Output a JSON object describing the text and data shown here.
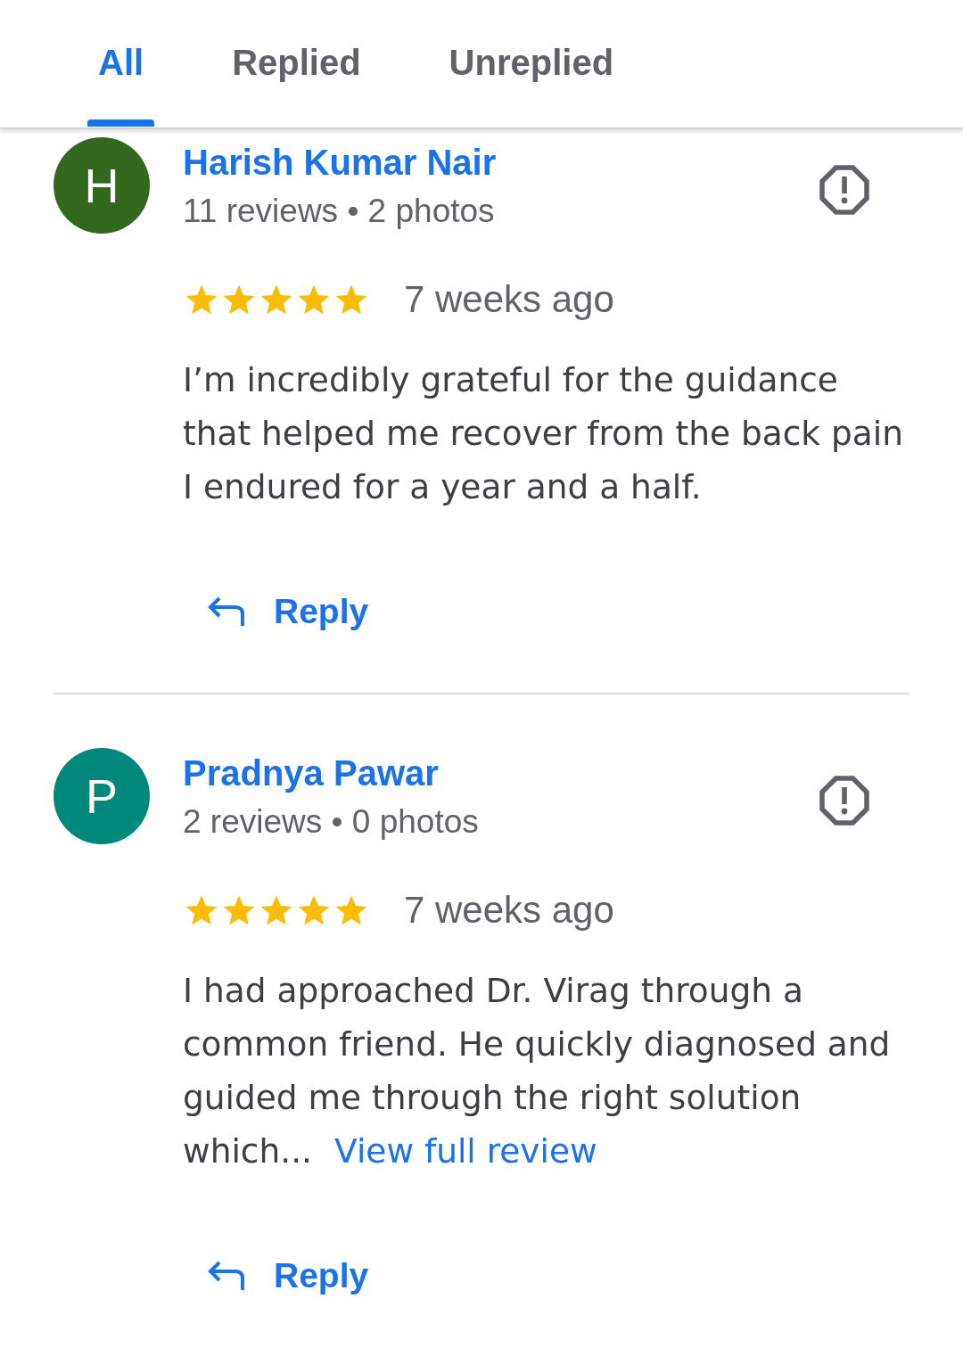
{
  "tabs": [
    {
      "label": "All",
      "selected": true
    },
    {
      "label": "Replied",
      "selected": false
    },
    {
      "label": "Unreplied",
      "selected": false
    }
  ],
  "reviews": [
    {
      "initial": "H",
      "color": "#33691e",
      "name": "Harish Kumar Nair",
      "stats": "11 reviews • 2 photos",
      "stars": 5,
      "time": "7 weeks ago",
      "text": "I’m incredibly grateful for the guidance that helped me recover from the back pain I endured for a year and a half.",
      "reply": "Reply"
    },
    {
      "initial": "P",
      "color": "#00897b",
      "name": "Pradnya Pawar",
      "stats": "2 reviews • 0 photos",
      "stars": 5,
      "time": "7 weeks ago",
      "text": "I had approached Dr. Virag through a common friend. He quickly diagnosed and guided me through the right solution which...",
      "more_link": "View full review",
      "reply": "Reply"
    }
  ]
}
